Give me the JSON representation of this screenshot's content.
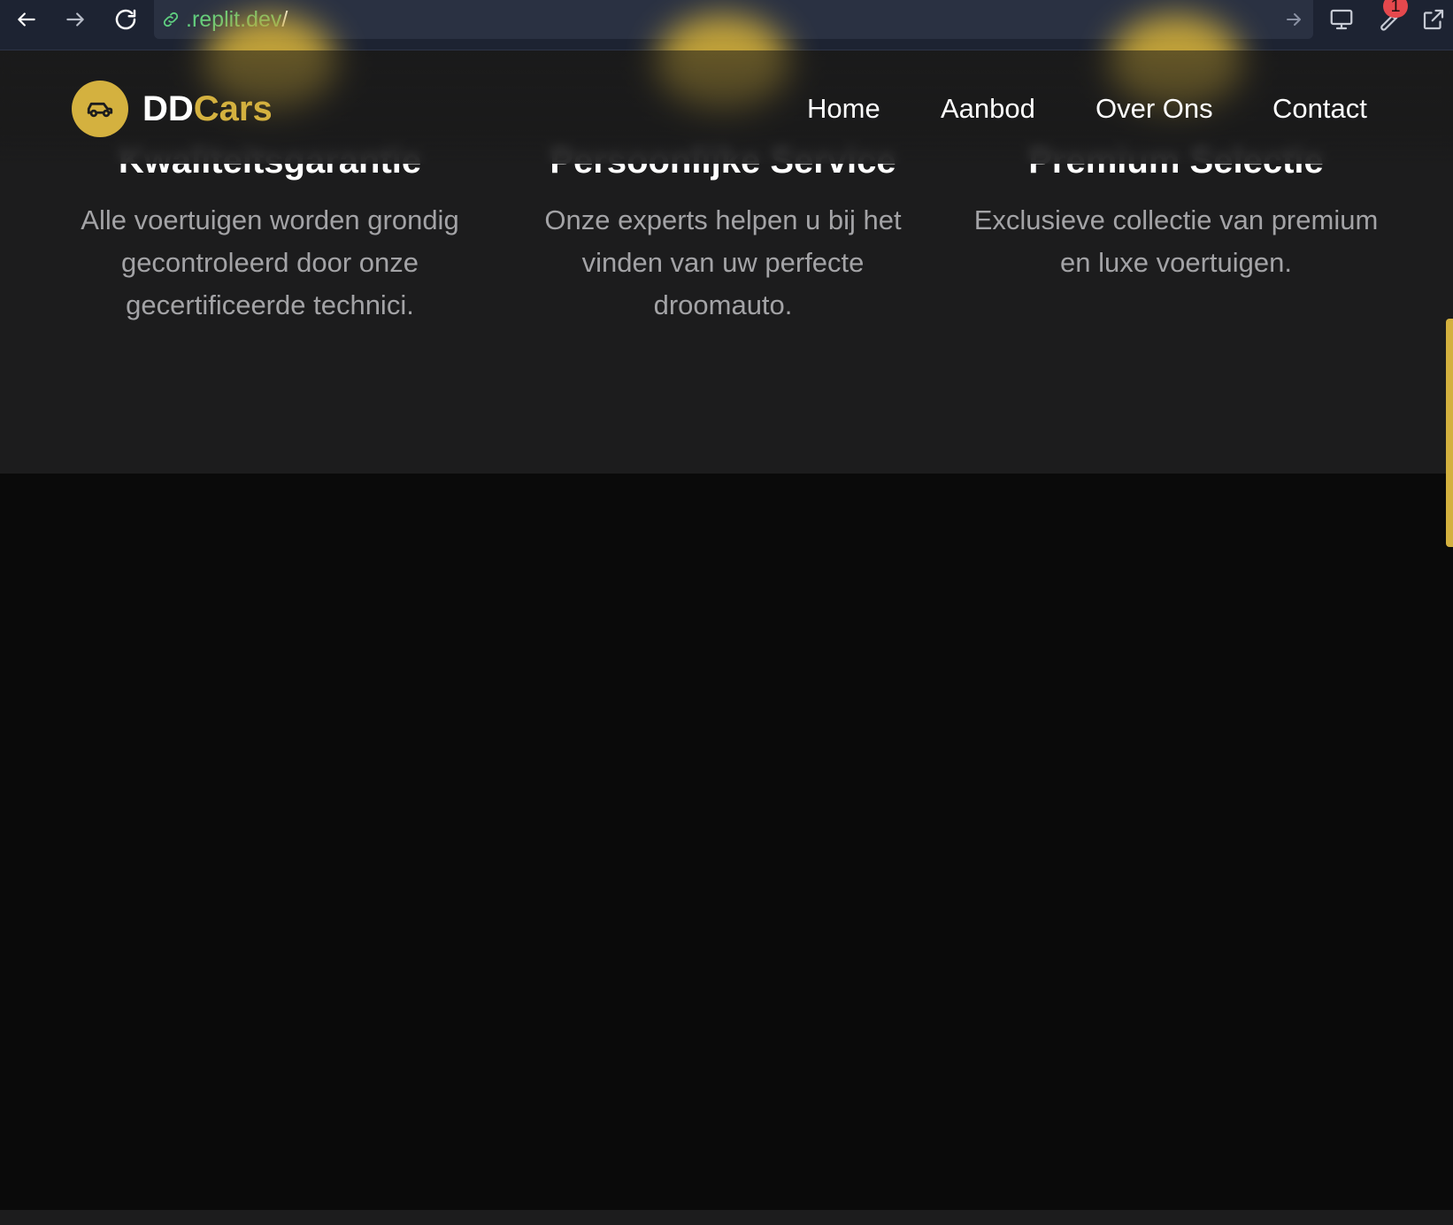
{
  "browser": {
    "url_domain": ".replit.dev",
    "url_path": "/",
    "notification_count": "1"
  },
  "nav": {
    "brand_primary": "DD",
    "brand_accent": "Cars",
    "links": [
      "Home",
      "Aanbod",
      "Over Ons",
      "Contact"
    ]
  },
  "features": [
    {
      "title": "Kwaliteitsgarantie",
      "description": "Alle voertuigen worden grondig gecontroleerd door onze gecertificeerde technici."
    },
    {
      "title": "Persoonlijke Service",
      "description": "Onze experts helpen u bij het vinden van uw perfecte droomauto."
    },
    {
      "title": "Premium Selectie",
      "description": "Exclusieve collectie van premium en luxe voertuigen."
    }
  ],
  "colors": {
    "accent": "#d4b13f",
    "background": "#1c1c1d",
    "page_dark": "#0a0a0a",
    "url_green": "#5fcf80"
  }
}
